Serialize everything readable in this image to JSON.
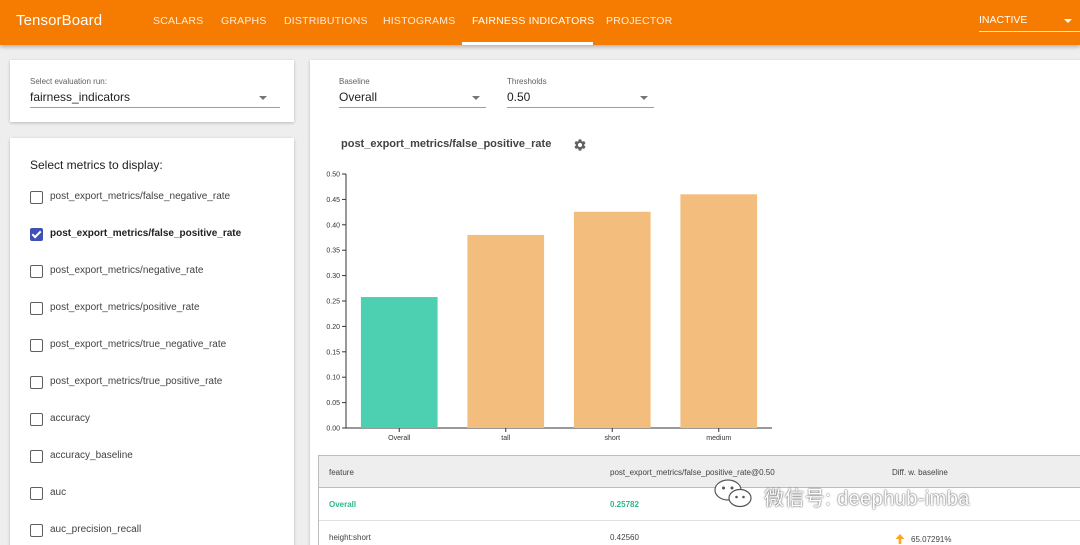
{
  "header": {
    "brand": "TensorBoard",
    "tabs": [
      {
        "label": "SCALARS"
      },
      {
        "label": "GRAPHS"
      },
      {
        "label": "DISTRIBUTIONS"
      },
      {
        "label": "HISTOGRAMS"
      },
      {
        "label": "FAIRNESS INDICATORS",
        "active": true
      },
      {
        "label": "PROJECTOR"
      }
    ],
    "inactive_label": "INACTIVE",
    "color": "#f57c00"
  },
  "eval_run": {
    "label": "Select evaluation run:",
    "value": "fairness_indicators"
  },
  "metrics": {
    "title": "Select metrics to display:",
    "items": [
      {
        "label": "post_export_metrics/false_negative_rate",
        "checked": false
      },
      {
        "label": "post_export_metrics/false_positive_rate",
        "checked": true
      },
      {
        "label": "post_export_metrics/negative_rate",
        "checked": false
      },
      {
        "label": "post_export_metrics/positive_rate",
        "checked": false
      },
      {
        "label": "post_export_metrics/true_negative_rate",
        "checked": false
      },
      {
        "label": "post_export_metrics/true_positive_rate",
        "checked": false
      },
      {
        "label": "accuracy",
        "checked": false
      },
      {
        "label": "accuracy_baseline",
        "checked": false
      },
      {
        "label": "auc",
        "checked": false
      },
      {
        "label": "auc_precision_recall",
        "checked": false
      }
    ],
    "checkbox_color": "#3f51b5"
  },
  "filters": {
    "baseline": {
      "label": "Baseline",
      "value": "Overall"
    },
    "thresholds": {
      "label": "Thresholds",
      "value": "0.50"
    }
  },
  "chart": {
    "title": "post_export_metrics/false_positive_rate",
    "settings_icon": "gear-icon"
  },
  "chart_data": {
    "type": "bar",
    "categories": [
      "Overall",
      "tall",
      "short",
      "medium"
    ],
    "values": [
      0.25782,
      0.38,
      0.4256,
      0.46
    ],
    "ylim": [
      0,
      0.5
    ],
    "yticks": [
      "0.00",
      "0.05",
      "0.10",
      "0.15",
      "0.20",
      "0.25",
      "0.30",
      "0.35",
      "0.40",
      "0.45",
      "0.50"
    ],
    "colors": {
      "baseline": "#4dd0b1",
      "other": "#f2bd7d"
    },
    "grid": false
  },
  "table": {
    "headers": [
      "feature",
      "post_export_metrics/false_positive_rate@0.50",
      "Diff. w. baseline"
    ],
    "rows": [
      {
        "feature": "Overall",
        "value": "0.25782",
        "diff": ""
      },
      {
        "feature": "height:short",
        "value": "0.42560",
        "diff": "65.07291%"
      }
    ],
    "diff_arrow_color": "#f9a825"
  },
  "watermark": {
    "text": "微信号: deephub-imba"
  }
}
